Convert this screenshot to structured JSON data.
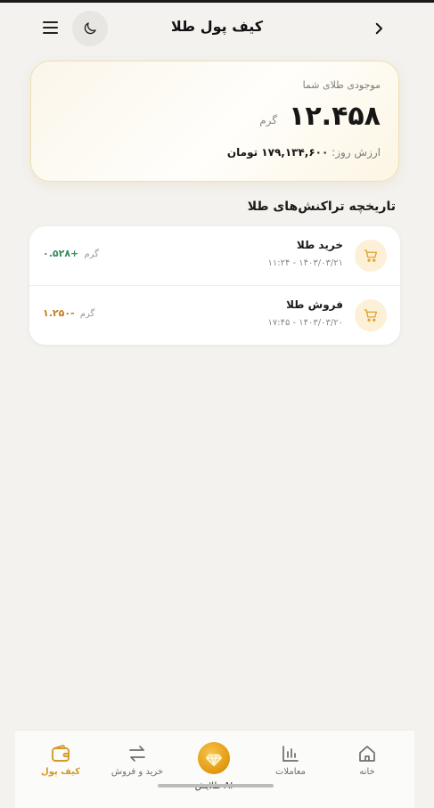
{
  "header": {
    "title": "کیف پول طلا",
    "menu_icon": "hamburger-menu-icon",
    "theme_icon": "moon-icon",
    "back_icon": "chevron-right-icon"
  },
  "balance": {
    "label": "موجودی طلای شما",
    "amount": "۱۲.۴۵۸",
    "unit": "گرم",
    "value_label": "ارزش روز:",
    "value": "۱۷۹,۱۳۴,۶۰۰ تومان"
  },
  "transactions": {
    "title": "تاریخچه تراکنش‌های طلا",
    "items": [
      {
        "title": "خرید طلا",
        "date": "۱۱:۲۴ - ۱۴۰۳/۰۳/۲۱",
        "amount": "+۰.۵۲۸",
        "unit": "گرم",
        "type": "buy",
        "icon": "cart-icon"
      },
      {
        "title": "فروش طلا",
        "date": "۱۷:۴۵ - ۱۴۰۳/۰۳/۲۰",
        "amount": "-۱.۲۵۰",
        "unit": "گرم",
        "type": "sell",
        "icon": "cart-icon"
      }
    ]
  },
  "nav": {
    "items": [
      {
        "label": "کیف پول",
        "icon": "wallet-icon",
        "active": true
      },
      {
        "label": "خرید و فروش",
        "icon": "swap-arrows-icon",
        "active": false
      },
      {
        "label": "طلایش AI",
        "icon": "gold-logo-icon",
        "active": false
      },
      {
        "label": "معاملات",
        "icon": "bar-chart-icon",
        "active": false
      },
      {
        "label": "خانه",
        "icon": "home-icon",
        "active": false
      }
    ]
  },
  "colors": {
    "accent_gold": "#d49a2a",
    "positive": "#3a8a5a",
    "negative": "#c47d1b",
    "background": "#f3f2ef"
  }
}
